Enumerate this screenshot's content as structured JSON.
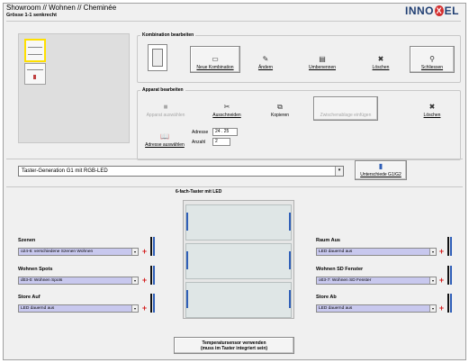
{
  "header": {
    "title": "Showroom // Wohnen  // Cheminée",
    "subtitle": "Grösse 1-1 senkrecht",
    "logo_text": "INNOXEL"
  },
  "kombination": {
    "legend": "Kombination bearbeiten",
    "buttons": [
      {
        "label": "Neue Kombination",
        "icon": "new-document-icon"
      },
      {
        "label": "Ändern",
        "icon": "edit-icon"
      },
      {
        "label": "Umbenennen",
        "icon": "rename-icon"
      },
      {
        "label": "Löschen",
        "icon": "delete-icon"
      },
      {
        "label": "Schliessen",
        "icon": "close-door-icon"
      }
    ]
  },
  "apparat": {
    "legend": "Apparat bearbeiten",
    "buttons": [
      {
        "label": "Apparat auswählen",
        "icon": "select-device-icon",
        "enabled": true
      },
      {
        "label": "Ausschneiden",
        "icon": "cut-icon",
        "enabled": true
      },
      {
        "label": "Kopieren",
        "icon": "copy-icon",
        "enabled": true
      },
      {
        "label": "Zwischenablage einfügen",
        "icon": "paste-icon",
        "enabled": false
      },
      {
        "label": "Löschen",
        "icon": "delete-icon",
        "enabled": true
      }
    ],
    "adresse_button": "Adresse auswählen",
    "adresse_label": "Adresse",
    "adresse_value": "24 . 25",
    "anzahl_label": "Anzahl",
    "anzahl_value": "2"
  },
  "generation": {
    "selected": "Taster-Generation G1 mit RGB-LED",
    "diff_button": "Unterschiede G1/G2"
  },
  "device": {
    "title": "6-fach-Taster mit LED"
  },
  "functions_left": [
    {
      "label": "Szenen",
      "value": "o24-6: verschiedene Szenen Wohnen"
    },
    {
      "label": "Wohnen Spots",
      "value": "d03-0: Wohnen Spots"
    },
    {
      "label": "Store Auf",
      "value": "LED dauernd aus"
    }
  ],
  "functions_right": [
    {
      "label": "Raum Aus",
      "value": "LED dauernd aus"
    },
    {
      "label": "Wohnen SD Fenster",
      "value": "o03-7: Wohnen SD Fenster"
    },
    {
      "label": "Store Ab",
      "value": "LED dauernd aus"
    }
  ],
  "temp_button": {
    "line1": "Temperatursensor verwenden",
    "line2": "(muss im Taster integriert sein)"
  },
  "colors": {
    "selection_yellow": "#ffe000",
    "led_blue": "#2f5fb8",
    "logo_blue": "#1f3e72",
    "logo_red": "#d32f2f",
    "list_lilac": "#c8c8ee"
  }
}
